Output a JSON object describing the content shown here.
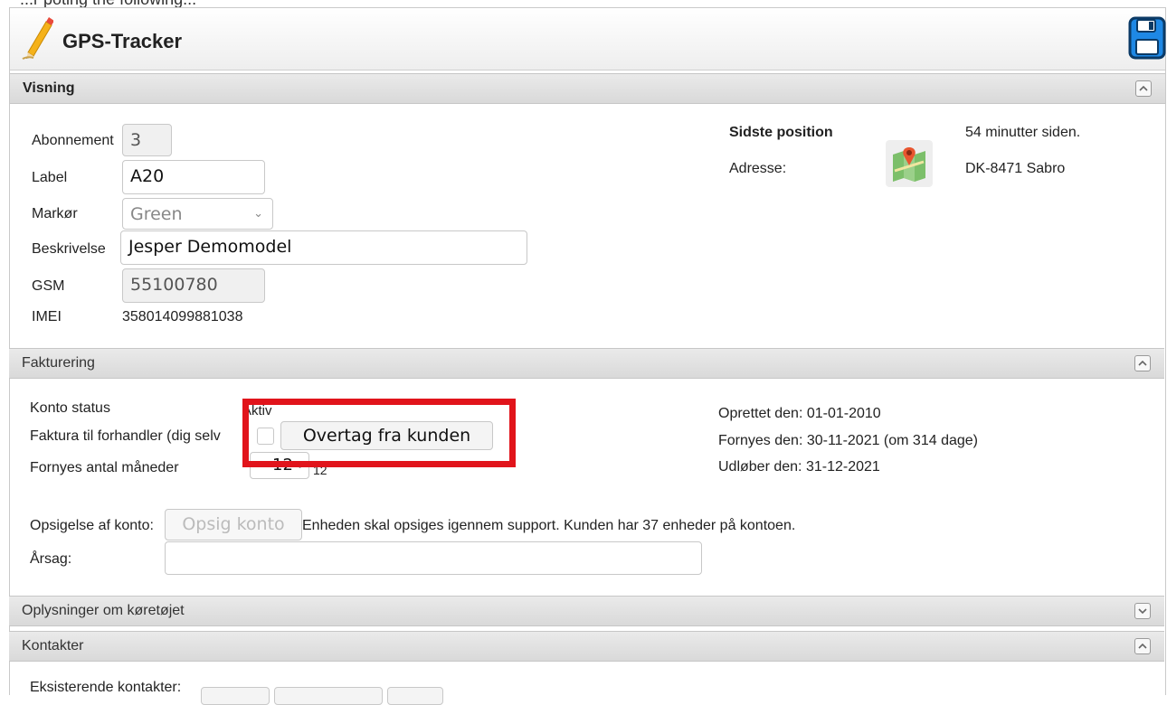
{
  "top_partial_text": "...r poting the following...",
  "app": {
    "title": "GPS-Tracker"
  },
  "visning": {
    "title": "Visning",
    "abonnement_label": "Abonnement",
    "abonnement_value": "3",
    "label_label": "Label",
    "label_value": "A20",
    "markor_label": "Markør",
    "markor_value": "Green",
    "beskrivelse_label": "Beskrivelse",
    "beskrivelse_value": "Jesper Demomodel",
    "gsm_label": "GSM",
    "gsm_value": "55100780",
    "imei_label": "IMEI",
    "imei_value": "358014099881038",
    "sidste_position_label": "Sidste position",
    "sidste_position_value": "54 minutter siden.",
    "adresse_label": "Adresse:",
    "adresse_value": "DK-8471 Sabro"
  },
  "fakturering": {
    "title": "Fakturering",
    "konto_status_label": "Konto status",
    "konto_status_value": "Aktiv",
    "faktura_label": "Faktura til forhandler (dig selv",
    "overtag_button": "Overtag fra kunden",
    "fornyes_antal_label": "Fornyes antal måneder",
    "fornyes_antal_select": "12",
    "fornyes_antal_value": "12",
    "oprettet": "Oprettet den: 01-01-2010",
    "fornyes": "Fornyes den: 30-11-2021 (om 314 dage)",
    "udlober": "Udløber den: 31-12-2021",
    "opsigelse_label": "Opsigelse af konto:",
    "opsig_button": "Opsig konto",
    "opsigelse_note": "Enheden skal opsiges igennem support. Kunden har 37 enheder på kontoen.",
    "aarsag_label": "Årsag:",
    "aarsag_value": ""
  },
  "oplysninger": {
    "title": "Oplysninger om køretøjet"
  },
  "kontakter": {
    "title": "Kontakter",
    "eksisterende_label": "Eksisterende kontakter:"
  },
  "colors": {
    "highlight": "#e1141b",
    "header_bg": "#dedede"
  },
  "icons": [
    "pencil-icon",
    "save-disk-icon",
    "map-icon",
    "collapse-up-icon",
    "expand-down-icon"
  ]
}
